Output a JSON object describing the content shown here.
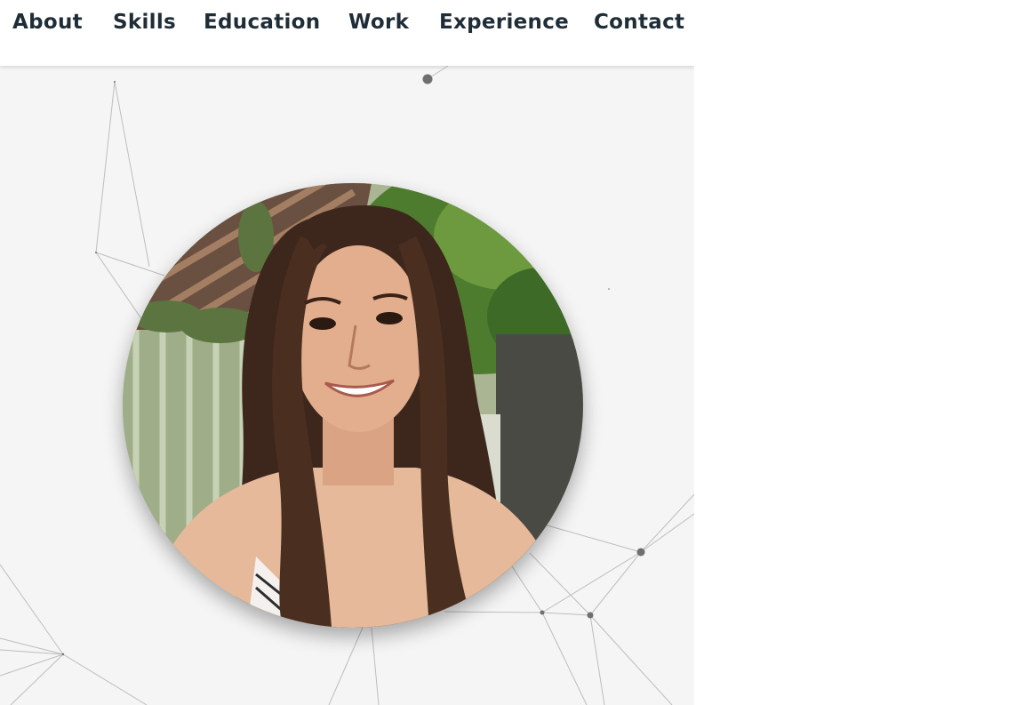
{
  "nav": {
    "items": [
      {
        "label": "About"
      },
      {
        "label": "Skills"
      },
      {
        "label": "Education"
      },
      {
        "label": "Work"
      },
      {
        "label": "Experience"
      },
      {
        "label": "Contact"
      }
    ]
  },
  "colors": {
    "nav_text": "#1f2d38",
    "nav_bg": "#ffffff",
    "page_bg": "#f5f5f5",
    "network_line": "#b9b9b9",
    "network_node": "#6d6d6d"
  }
}
